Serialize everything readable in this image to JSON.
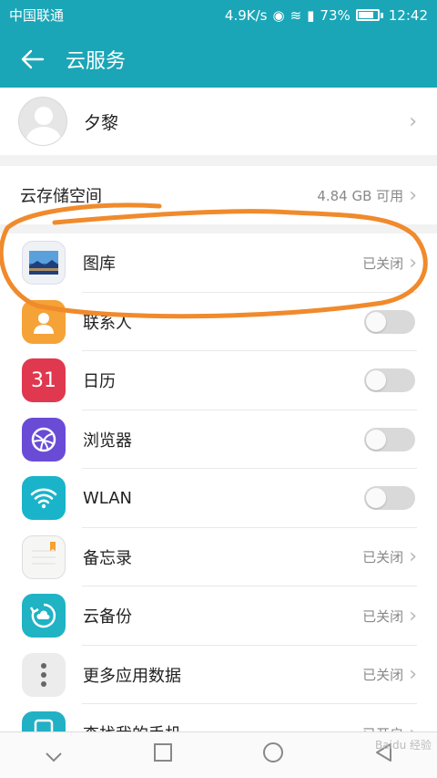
{
  "status_bar": {
    "carrier": "中国联通",
    "speed": "4.9K/s",
    "battery": "73%",
    "time": "12:42"
  },
  "app_bar": {
    "back_icon": "back-arrow-icon",
    "title": "云服务"
  },
  "profile": {
    "name": "夕黎"
  },
  "storage": {
    "label": "云存储空间",
    "value": "4.84 GB 可用"
  },
  "items": [
    {
      "label": "图库",
      "status": "已关闭",
      "icon": "gallery-icon"
    },
    {
      "label": "联系人",
      "icon": "contacts-icon",
      "toggle": false
    },
    {
      "label": "日历",
      "icon": "calendar-icon",
      "icon_text": "31",
      "toggle": false
    },
    {
      "label": "浏览器",
      "icon": "browser-icon",
      "toggle": false
    },
    {
      "label": "WLAN",
      "icon": "wifi-icon",
      "toggle": false
    },
    {
      "label": "备忘录",
      "status": "已关闭",
      "icon": "notes-icon"
    },
    {
      "label": "云备份",
      "status": "已关闭",
      "icon": "cloud-backup-icon"
    },
    {
      "label": "更多应用数据",
      "status": "已关闭",
      "icon": "more-icon"
    },
    {
      "label": "查找我的手机",
      "status": "已开启",
      "icon": "find-phone-icon"
    }
  ],
  "nav_bar": {
    "icons": [
      "collapse-icon",
      "recents-icon",
      "home-icon",
      "back-icon"
    ]
  },
  "watermark": "Baidu 经验",
  "colors": {
    "accent": "#1aa6b7",
    "annotation": "#f08a2c"
  }
}
